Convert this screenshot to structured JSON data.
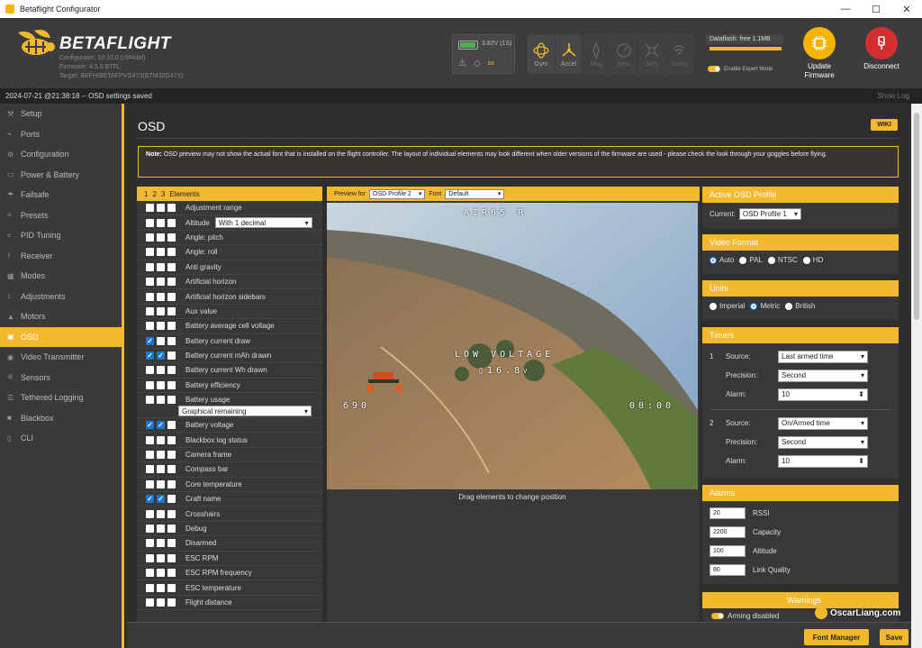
{
  "window": {
    "title": "Betaflight Configurator"
  },
  "header": {
    "brand": "BETAFLIGHT",
    "configurator_version": "Configurator: 10.10.0 (c5f4daf)",
    "firmware_version": "Firmware: 4.5.0 BTFL",
    "target": "Target: BEFH/BETAFPVG473(STM32G47X)",
    "voltage": "3.82V (1S)",
    "battery_level": 0.85,
    "sensors": [
      {
        "label": "Gyro",
        "active": true,
        "icon": "gyro-icon"
      },
      {
        "label": "Accel",
        "active": true,
        "icon": "accel-icon"
      },
      {
        "label": "Mag",
        "active": false,
        "icon": "mag-icon"
      },
      {
        "label": "Baro",
        "active": false,
        "icon": "baro-icon"
      },
      {
        "label": "GPS",
        "active": false,
        "icon": "gps-icon"
      },
      {
        "label": "Sonar",
        "active": false,
        "icon": "sonar-icon"
      }
    ],
    "dataflash": "Dataflash: free 1.1MB",
    "expert_mode": "Enable Expert Mode",
    "update_firmware": "Update Firmware",
    "disconnect": "Disconnect"
  },
  "log": {
    "message": "2024-07-21 @21:38:18 -- OSD settings saved",
    "show_log": "Show Log"
  },
  "sidebar": {
    "items": [
      {
        "label": "Setup",
        "icon": "wrench-icon"
      },
      {
        "label": "Ports",
        "icon": "plug-icon"
      },
      {
        "label": "Configuration",
        "icon": "gear-icon"
      },
      {
        "label": "Power & Battery",
        "icon": "battery-icon"
      },
      {
        "label": "Failsafe",
        "icon": "parachute-icon"
      },
      {
        "label": "Presets",
        "icon": "sliders-icon"
      },
      {
        "label": "PID Tuning",
        "icon": "tuning-icon"
      },
      {
        "label": "Receiver",
        "icon": "receiver-icon"
      },
      {
        "label": "Modes",
        "icon": "modes-icon"
      },
      {
        "label": "Adjustments",
        "icon": "adjust-icon"
      },
      {
        "label": "Motors",
        "icon": "motor-icon"
      },
      {
        "label": "OSD",
        "icon": "osd-icon",
        "active": true
      },
      {
        "label": "Video Transmitter",
        "icon": "vtx-icon"
      },
      {
        "label": "Sensors",
        "icon": "sensors-icon"
      },
      {
        "label": "Tethered Logging",
        "icon": "tether-icon"
      },
      {
        "label": "Blackbox",
        "icon": "blackbox-icon"
      },
      {
        "label": "CLI",
        "icon": "cli-icon"
      }
    ]
  },
  "osd": {
    "title": "OSD",
    "wiki": "WIKI",
    "note_bold": "Note:",
    "note_text": "OSD preview may not show the actual font that is installed on the flight controller. The layout of individual elements may look different when older versions of the firmware are used - please check the look through your goggles before flying.",
    "elements_header": {
      "p1": "1",
      "p2": "2",
      "p3": "3",
      "label": "Elements"
    },
    "elements": [
      {
        "name": "Adjustment range",
        "c": [
          false,
          false,
          false
        ]
      },
      {
        "name": "Altitude",
        "c": [
          false,
          false,
          false
        ],
        "select": "With 1 decimal"
      },
      {
        "name": "Angle: pitch",
        "c": [
          false,
          false,
          false
        ]
      },
      {
        "name": "Angle: roll",
        "c": [
          false,
          false,
          false
        ]
      },
      {
        "name": "Anti gravity",
        "c": [
          false,
          false,
          false
        ]
      },
      {
        "name": "Artificial horizon",
        "c": [
          false,
          false,
          false
        ]
      },
      {
        "name": "Artificial horizon sidebars",
        "c": [
          false,
          false,
          false
        ]
      },
      {
        "name": "Aux value",
        "c": [
          false,
          false,
          false
        ]
      },
      {
        "name": "Battery average cell voltage",
        "c": [
          false,
          false,
          false
        ]
      },
      {
        "name": "Battery current draw",
        "c": [
          true,
          false,
          false
        ]
      },
      {
        "name": "Battery current mAh drawn",
        "c": [
          true,
          true,
          false
        ]
      },
      {
        "name": "Battery current Wh drawn",
        "c": [
          false,
          false,
          false
        ]
      },
      {
        "name": "Battery efficiency",
        "c": [
          false,
          false,
          false
        ]
      },
      {
        "name": "Battery usage",
        "c": [
          false,
          false,
          false
        ],
        "select_below": "Graphical remaining"
      },
      {
        "name": "Battery voltage",
        "c": [
          true,
          true,
          false
        ]
      },
      {
        "name": "Blackbox log status",
        "c": [
          false,
          false,
          false
        ]
      },
      {
        "name": "Camera frame",
        "c": [
          false,
          false,
          false
        ]
      },
      {
        "name": "Compass bar",
        "c": [
          false,
          false,
          false
        ]
      },
      {
        "name": "Core temperature",
        "c": [
          false,
          false,
          false
        ]
      },
      {
        "name": "Craft name",
        "c": [
          true,
          true,
          false
        ]
      },
      {
        "name": "Crosshairs",
        "c": [
          false,
          false,
          false
        ]
      },
      {
        "name": "Debug",
        "c": [
          false,
          false,
          false
        ]
      },
      {
        "name": "Disarmed",
        "c": [
          false,
          false,
          false
        ]
      },
      {
        "name": "ESC RPM",
        "c": [
          false,
          false,
          false
        ]
      },
      {
        "name": "ESC RPM frequency",
        "c": [
          false,
          false,
          false
        ]
      },
      {
        "name": "ESC temperature",
        "c": [
          false,
          false,
          false
        ]
      },
      {
        "name": "Flight distance",
        "c": [
          false,
          false,
          false
        ]
      }
    ],
    "preview": {
      "preview_for_label": "Preview for",
      "profile": "OSD Profile 2",
      "font_label": "Font",
      "font": "Default",
      "craft_name": "AIR65 R",
      "warning": "LOW VOLTAGE",
      "voltage": "16.8",
      "voltage_unit": "V",
      "mah": "690",
      "timer": "00:00",
      "drag_hint": "Drag elements to change position"
    },
    "active_profile": {
      "title": "Active OSD Profile",
      "current_label": "Current:",
      "current": "OSD Profile 1"
    },
    "video_format": {
      "title": "Video Format",
      "options": [
        {
          "label": "Auto",
          "selected": true
        },
        {
          "label": "PAL",
          "selected": false
        },
        {
          "label": "NTSC",
          "selected": false
        },
        {
          "label": "HD",
          "selected": false
        }
      ]
    },
    "units": {
      "title": "Units",
      "options": [
        {
          "label": "Imperial",
          "selected": false
        },
        {
          "label": "Metric",
          "selected": true
        },
        {
          "label": "British",
          "selected": false
        }
      ]
    },
    "timers": {
      "title": "Timers",
      "source_label": "Source:",
      "precision_label": "Precision:",
      "alarm_label": "Alarm:",
      "items": [
        {
          "index": "1",
          "source": "Last armed time",
          "precision": "Second",
          "alarm": "10"
        },
        {
          "index": "2",
          "source": "On/Armed time",
          "precision": "Second",
          "alarm": "10"
        }
      ]
    },
    "alarms": {
      "title": "Alarms",
      "items": [
        {
          "value": "20",
          "label": "RSSI"
        },
        {
          "value": "2200",
          "label": "Capacity"
        },
        {
          "value": "100",
          "label": "Altitude"
        },
        {
          "value": "80",
          "label": "Link Quality"
        }
      ]
    },
    "warnings": {
      "title": "Warnings",
      "first": "Arming disabled"
    },
    "footer": {
      "font_manager": "Font Manager",
      "save": "Save"
    }
  },
  "watermark": "OscarLiang.com",
  "colors": {
    "accent": "#f2b92e",
    "checkbox": "#1976d2",
    "update": "#f4b400",
    "disconnect": "#d32f2f"
  }
}
